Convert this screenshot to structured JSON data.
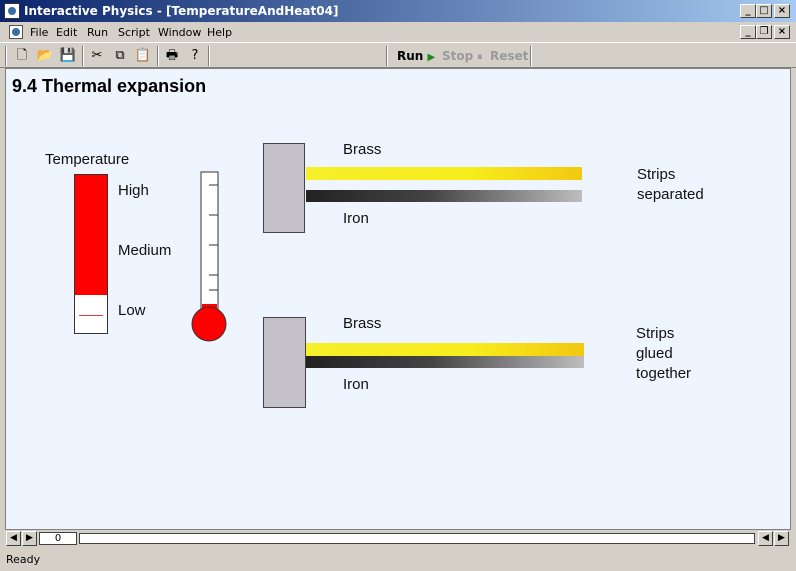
{
  "window": {
    "title": "Interactive Physics - [TemperatureAndHeat04]"
  },
  "menu": [
    "File",
    "Edit",
    "Run",
    "Script",
    "Window",
    "Help"
  ],
  "toolbar": {
    "icons": [
      "new-file-icon",
      "open-folder-icon",
      "save-icon",
      "cut-icon",
      "copy-icon",
      "paste-icon",
      "print-icon",
      "help-icon"
    ],
    "run_label": "Run",
    "stop_label": "Stop",
    "reset_label": "Reset",
    "run_color": "#1a8a1a"
  },
  "document": {
    "heading": "9.4 Thermal expansion",
    "temperature": {
      "title": "Temperature",
      "high": "High",
      "medium": "Medium",
      "low": "Low",
      "level_fraction": 0.75,
      "fill_color": "#ff0000"
    },
    "strip_top": {
      "brass_label": "Brass",
      "iron_label": "Iron",
      "note_line1": "Strips",
      "note_line2": "separated"
    },
    "strip_bottom": {
      "brass_label": "Brass",
      "iron_label": "Iron",
      "note_line1": "Strips",
      "note_line2": "glued",
      "note_line3": "together"
    }
  },
  "scrollbar": {
    "frame_value": "0"
  },
  "status": {
    "text": "Ready"
  }
}
